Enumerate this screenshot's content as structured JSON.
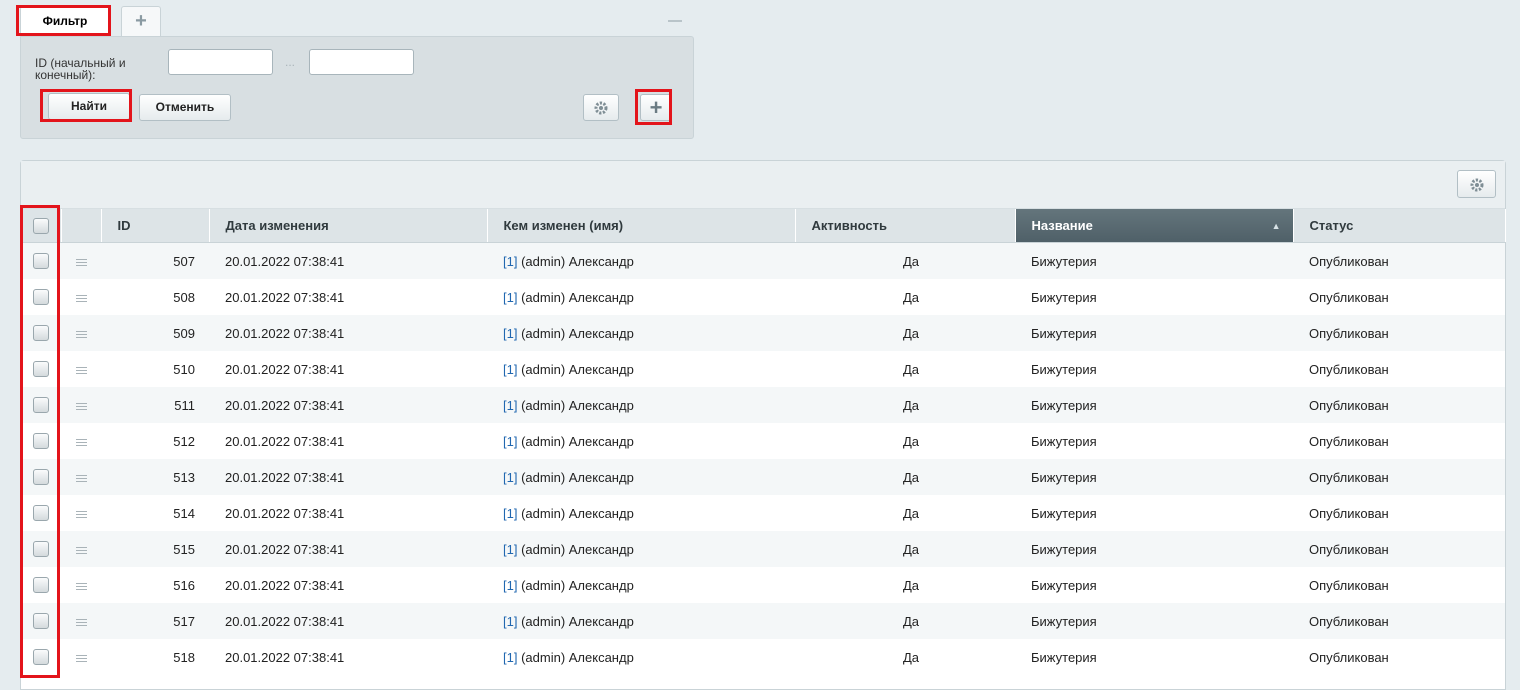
{
  "filter": {
    "tab_label": "Фильтр",
    "add_tab_label": "+",
    "id_label": "ID (начальный и конечный):",
    "id_from_value": "",
    "id_to_value": "",
    "range_separator": "...",
    "find_label": "Найти",
    "cancel_label": "Отменить",
    "add_field_label": "+"
  },
  "grid": {
    "columns": [
      "ID",
      "Дата изменения",
      "Кем изменен (имя)",
      "Активность",
      "Название",
      "Статус"
    ],
    "sorted_column": "Название",
    "sort_direction": "asc",
    "rows": [
      {
        "id": "507",
        "date": "20.01.2022 07:38:41",
        "user_id": "[1]",
        "user_name": " (admin) Александр",
        "active": "Да",
        "name": "Бижутерия",
        "status": "Опубликован"
      },
      {
        "id": "508",
        "date": "20.01.2022 07:38:41",
        "user_id": "[1]",
        "user_name": " (admin) Александр",
        "active": "Да",
        "name": "Бижутерия",
        "status": "Опубликован"
      },
      {
        "id": "509",
        "date": "20.01.2022 07:38:41",
        "user_id": "[1]",
        "user_name": " (admin) Александр",
        "active": "Да",
        "name": "Бижутерия",
        "status": "Опубликован"
      },
      {
        "id": "510",
        "date": "20.01.2022 07:38:41",
        "user_id": "[1]",
        "user_name": " (admin) Александр",
        "active": "Да",
        "name": "Бижутерия",
        "status": "Опубликован"
      },
      {
        "id": "511",
        "date": "20.01.2022 07:38:41",
        "user_id": "[1]",
        "user_name": " (admin) Александр",
        "active": "Да",
        "name": "Бижутерия",
        "status": "Опубликован"
      },
      {
        "id": "512",
        "date": "20.01.2022 07:38:41",
        "user_id": "[1]",
        "user_name": " (admin) Александр",
        "active": "Да",
        "name": "Бижутерия",
        "status": "Опубликован"
      },
      {
        "id": "513",
        "date": "20.01.2022 07:38:41",
        "user_id": "[1]",
        "user_name": " (admin) Александр",
        "active": "Да",
        "name": "Бижутерия",
        "status": "Опубликован"
      },
      {
        "id": "514",
        "date": "20.01.2022 07:38:41",
        "user_id": "[1]",
        "user_name": " (admin) Александр",
        "active": "Да",
        "name": "Бижутерия",
        "status": "Опубликован"
      },
      {
        "id": "515",
        "date": "20.01.2022 07:38:41",
        "user_id": "[1]",
        "user_name": " (admin) Александр",
        "active": "Да",
        "name": "Бижутерия",
        "status": "Опубликован"
      },
      {
        "id": "516",
        "date": "20.01.2022 07:38:41",
        "user_id": "[1]",
        "user_name": " (admin) Александр",
        "active": "Да",
        "name": "Бижутерия",
        "status": "Опубликован"
      },
      {
        "id": "517",
        "date": "20.01.2022 07:38:41",
        "user_id": "[1]",
        "user_name": " (admin) Александр",
        "active": "Да",
        "name": "Бижутерия",
        "status": "Опубликован"
      },
      {
        "id": "518",
        "date": "20.01.2022 07:38:41",
        "user_id": "[1]",
        "user_name": " (admin) Александр",
        "active": "Да",
        "name": "Бижутерия",
        "status": "Опубликован"
      }
    ]
  },
  "icons": {
    "gear": "gear-icon",
    "plus": "plus-icon",
    "minus": "minus-icon",
    "menu": "hamburger-icon",
    "checkbox": "checkbox",
    "sort_arrow": "sort-arrow-icon"
  },
  "colors": {
    "highlight": "#e3141b",
    "background": "#e5ecef",
    "sorted_header": "#55666e",
    "link": "#2067b0"
  }
}
